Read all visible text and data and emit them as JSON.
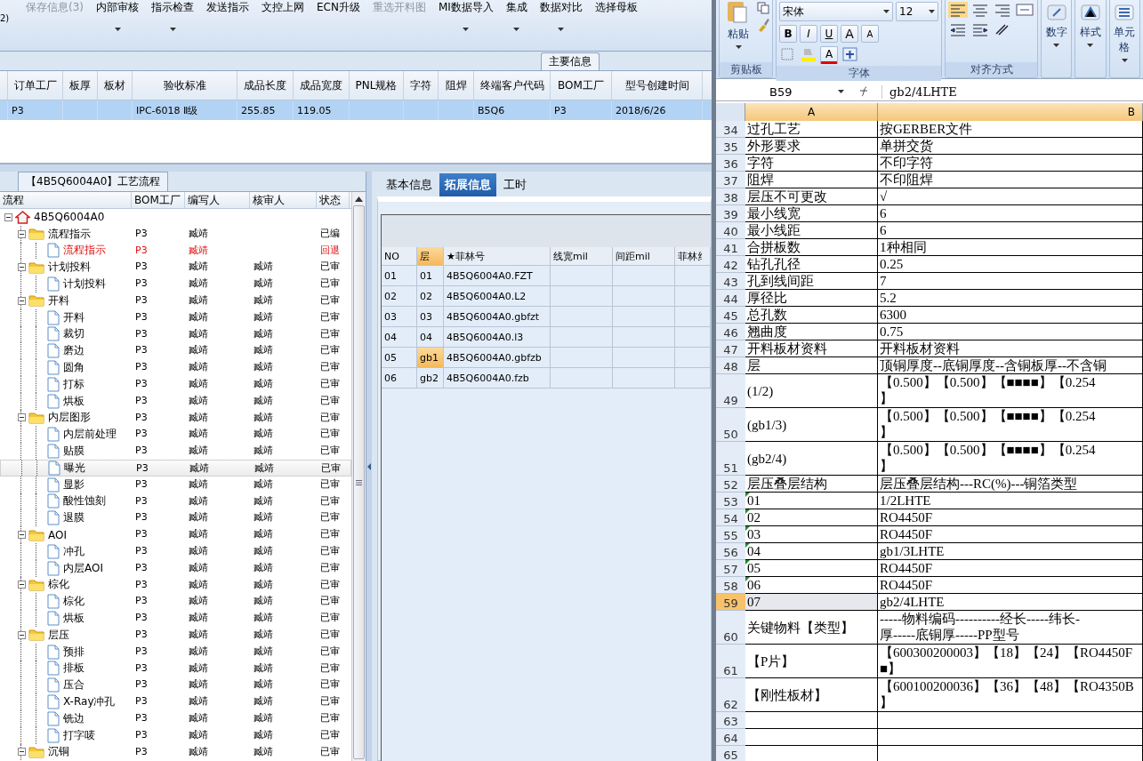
{
  "toolbar": {
    "note": "2)",
    "items": [
      {
        "label": "保存信息(3)",
        "disabled": true,
        "dropdown": false
      },
      {
        "label": "内部审核",
        "disabled": false,
        "dropdown": true
      },
      {
        "label": "指示检查",
        "disabled": false,
        "dropdown": true
      },
      {
        "label": "发送指示",
        "disabled": false,
        "dropdown": false
      },
      {
        "label": "文控上网",
        "disabled": false,
        "dropdown": false
      },
      {
        "label": "ECN升级",
        "disabled": false,
        "dropdown": false
      },
      {
        "label": "重选开料图",
        "disabled": true,
        "dropdown": false
      },
      {
        "label": "MI数据导入",
        "disabled": false,
        "dropdown": true
      },
      {
        "label": "集成",
        "disabled": false,
        "dropdown": true
      },
      {
        "label": "数据对比",
        "disabled": false,
        "dropdown": true
      },
      {
        "label": "选择母板",
        "disabled": false,
        "dropdown": false
      }
    ]
  },
  "main_info": {
    "title": "主要信息",
    "columns": [
      "订单工厂",
      "板厚",
      "板材",
      "验收标准",
      "成品长度",
      "成品宽度",
      "PNL规格",
      "字符",
      "阻焊",
      "终端客户代码",
      "BOM工厂",
      "型号创建时间"
    ],
    "rows": [
      {
        "selected": true,
        "cells": [
          "P3",
          null,
          null,
          "IPC-6018 Ⅱ级",
          "255.85",
          "119.05",
          null,
          null,
          null,
          "B5Q6",
          "P3",
          "2018/6/26"
        ]
      }
    ]
  },
  "process": {
    "title": "【4B5Q6004A0】工艺流程",
    "columns": [
      "流程",
      "BOM工厂",
      "编写人",
      "核审人",
      "状态"
    ],
    "tree": [
      {
        "label": "4B5Q6004A0",
        "kind": "root",
        "expanded": true,
        "alert": false,
        "selected": false,
        "children": [
          {
            "label": "流程指示",
            "kind": "folder",
            "expanded": true,
            "bom": "P3",
            "writer": "臧靖",
            "status": "已编",
            "alert": false,
            "selected": false,
            "children": [
              {
                "label": "流程指示",
                "kind": "doc",
                "bom": "P3",
                "writer": "臧靖",
                "status": "回退",
                "alert": true,
                "selected": false
              }
            ]
          },
          {
            "label": "计划投料",
            "kind": "folder",
            "expanded": true,
            "bom": "P3",
            "writer": "臧靖",
            "reviewer": "臧靖",
            "status": "已审",
            "alert": false,
            "selected": false,
            "children": [
              {
                "label": "计划投料",
                "kind": "doc",
                "bom": "P3",
                "writer": "臧靖",
                "reviewer": "臧靖",
                "status": "已审",
                "alert": false,
                "selected": false
              }
            ]
          },
          {
            "label": "开料",
            "kind": "folder",
            "expanded": true,
            "bom": "P3",
            "writer": "臧靖",
            "reviewer": "臧靖",
            "status": "已审",
            "alert": false,
            "selected": false,
            "children": [
              {
                "label": "开料",
                "kind": "doc",
                "bom": "P3",
                "writer": "臧靖",
                "reviewer": "臧靖",
                "status": "已审",
                "alert": false,
                "selected": false
              },
              {
                "label": "裁切",
                "kind": "doc",
                "bom": "P3",
                "writer": "臧靖",
                "reviewer": "臧靖",
                "status": "已审",
                "alert": false,
                "selected": false
              },
              {
                "label": "磨边",
                "kind": "doc",
                "bom": "P3",
                "writer": "臧靖",
                "reviewer": "臧靖",
                "status": "已审",
                "alert": false,
                "selected": false
              },
              {
                "label": "圆角",
                "kind": "doc",
                "bom": "P3",
                "writer": "臧靖",
                "reviewer": "臧靖",
                "status": "已审",
                "alert": false,
                "selected": false
              },
              {
                "label": "打标",
                "kind": "doc",
                "bom": "P3",
                "writer": "臧靖",
                "reviewer": "臧靖",
                "status": "已审",
                "alert": false,
                "selected": false
              },
              {
                "label": "烘板",
                "kind": "doc",
                "bom": "P3",
                "writer": "臧靖",
                "reviewer": "臧靖",
                "status": "已审",
                "alert": false,
                "selected": false
              }
            ]
          },
          {
            "label": "内层图形",
            "kind": "folder",
            "expanded": true,
            "bom": "P3",
            "writer": "臧靖",
            "reviewer": "臧靖",
            "status": "已审",
            "alert": false,
            "selected": false,
            "children": [
              {
                "label": "内层前处理",
                "kind": "doc",
                "bom": "P3",
                "writer": "臧靖",
                "reviewer": "臧靖",
                "status": "已审",
                "alert": false,
                "selected": false
              },
              {
                "label": "贴膜",
                "kind": "doc",
                "bom": "P3",
                "writer": "臧靖",
                "reviewer": "臧靖",
                "status": "已审",
                "alert": false,
                "selected": false
              },
              {
                "label": "曝光",
                "kind": "doc",
                "bom": "P3",
                "writer": "臧靖",
                "reviewer": "臧靖",
                "status": "已审",
                "alert": false,
                "selected": true
              },
              {
                "label": "显影",
                "kind": "doc",
                "bom": "P3",
                "writer": "臧靖",
                "reviewer": "臧靖",
                "status": "已审",
                "alert": false,
                "selected": false
              },
              {
                "label": "酸性蚀刻",
                "kind": "doc",
                "bom": "P3",
                "writer": "臧靖",
                "reviewer": "臧靖",
                "status": "已审",
                "alert": false,
                "selected": false
              },
              {
                "label": "退膜",
                "kind": "doc",
                "bom": "P3",
                "writer": "臧靖",
                "reviewer": "臧靖",
                "status": "已审",
                "alert": false,
                "selected": false
              }
            ]
          },
          {
            "label": "AOI",
            "kind": "folder",
            "expanded": true,
            "bom": "P3",
            "writer": "臧靖",
            "reviewer": "臧靖",
            "status": "已审",
            "alert": false,
            "selected": false,
            "children": [
              {
                "label": "冲孔",
                "kind": "doc",
                "bom": "P3",
                "writer": "臧靖",
                "reviewer": "臧靖",
                "status": "已审",
                "alert": false,
                "selected": false
              },
              {
                "label": "内层AOI",
                "kind": "doc",
                "bom": "P3",
                "writer": "臧靖",
                "reviewer": "臧靖",
                "status": "已审",
                "alert": false,
                "selected": false
              }
            ]
          },
          {
            "label": "棕化",
            "kind": "folder",
            "expanded": true,
            "bom": "P3",
            "writer": "臧靖",
            "reviewer": "臧靖",
            "status": "已审",
            "alert": false,
            "selected": false,
            "children": [
              {
                "label": "棕化",
                "kind": "doc",
                "bom": "P3",
                "writer": "臧靖",
                "reviewer": "臧靖",
                "status": "已审",
                "alert": false,
                "selected": false
              },
              {
                "label": "烘板",
                "kind": "doc",
                "bom": "P3",
                "writer": "臧靖",
                "reviewer": "臧靖",
                "status": "已审",
                "alert": false,
                "selected": false
              }
            ]
          },
          {
            "label": "层压",
            "kind": "folder",
            "expanded": true,
            "bom": "P3",
            "writer": "臧靖",
            "reviewer": "臧靖",
            "status": "已审",
            "alert": false,
            "selected": false,
            "children": [
              {
                "label": "预排",
                "kind": "doc",
                "bom": "P3",
                "writer": "臧靖",
                "reviewer": "臧靖",
                "status": "已审",
                "alert": false,
                "selected": false
              },
              {
                "label": "排板",
                "kind": "doc",
                "bom": "P3",
                "writer": "臧靖",
                "reviewer": "臧靖",
                "status": "已审",
                "alert": false,
                "selected": false
              },
              {
                "label": "压合",
                "kind": "doc",
                "bom": "P3",
                "writer": "臧靖",
                "reviewer": "臧靖",
                "status": "已审",
                "alert": false,
                "selected": false
              },
              {
                "label": "X-Ray冲孔",
                "kind": "doc",
                "bom": "P3",
                "writer": "臧靖",
                "reviewer": "臧靖",
                "status": "已审",
                "alert": false,
                "selected": false
              },
              {
                "label": "铣边",
                "kind": "doc",
                "bom": "P3",
                "writer": "臧靖",
                "reviewer": "臧靖",
                "status": "已审",
                "alert": false,
                "selected": false
              },
              {
                "label": "打字唛",
                "kind": "doc",
                "bom": "P3",
                "writer": "臧靖",
                "reviewer": "臧靖",
                "status": "已审",
                "alert": false,
                "selected": false
              }
            ]
          },
          {
            "label": "沉铜",
            "kind": "folder",
            "expanded": true,
            "bom": "P3",
            "writer": "臧靖",
            "reviewer": "臧靖",
            "status": "已审",
            "alert": false,
            "selected": false
          }
        ]
      }
    ]
  },
  "detail": {
    "tabs": [
      {
        "label": "基本信息",
        "selected": false
      },
      {
        "label": "拓展信息",
        "selected": true
      },
      {
        "label": "工时",
        "selected": false
      }
    ],
    "columns": [
      {
        "label": "NO",
        "selected": false
      },
      {
        "label": "层",
        "selected": true
      },
      {
        "label": "★菲林号",
        "selected": false
      },
      {
        "label": "线宽mil",
        "selected": false
      },
      {
        "label": "间距mil",
        "selected": false
      },
      {
        "label": "菲林纟",
        "selected": false
      }
    ],
    "rows": [
      {
        "no": "01",
        "layer": "01",
        "film": "4B5Q6004A0.FZT",
        "layer_selected": false
      },
      {
        "no": "02",
        "layer": "02",
        "film": "4B5Q6004A0.L2",
        "layer_selected": false
      },
      {
        "no": "03",
        "layer": "03",
        "film": "4B5Q6004A0.gbfzt",
        "layer_selected": false
      },
      {
        "no": "04",
        "layer": "04",
        "film": "4B5Q6004A0.l3",
        "layer_selected": false
      },
      {
        "no": "05",
        "layer": "gb1",
        "film": "4B5Q6004A0.gbfzb",
        "layer_selected": true
      },
      {
        "no": "06",
        "layer": "gb2",
        "film": "4B5Q6004A0.fzb",
        "layer_selected": false
      }
    ]
  },
  "excel": {
    "ribbon": {
      "paste": "粘贴",
      "font_name": "宋体",
      "font_size": "12",
      "format_buttons": [
        "B",
        "I",
        "U"
      ],
      "grow_buttons": [
        "A",
        "A"
      ],
      "font_color_button": "A",
      "groups": [
        "剪贴板",
        "字体",
        "对齐方式"
      ],
      "big_buttons": [
        "数字",
        "样式",
        "单元格"
      ]
    },
    "name_box": "B59",
    "formula": "gb2/4LHTE",
    "columns": [
      "A",
      "B"
    ],
    "rows": [
      {
        "row": "34",
        "a": "过孔工艺",
        "b": [
          "按GERBER文件"
        ],
        "flag": false,
        "selected": false
      },
      {
        "row": "35",
        "a": "外形要求",
        "b": [
          "单拼交货"
        ],
        "flag": false,
        "selected": false
      },
      {
        "row": "36",
        "a": "字符",
        "b": [
          "不印字符"
        ],
        "flag": false,
        "selected": false
      },
      {
        "row": "37",
        "a": "阻焊",
        "b": [
          "不印阻焊"
        ],
        "flag": false,
        "selected": false
      },
      {
        "row": "38",
        "a": "层压不可更改",
        "b": [
          "√"
        ],
        "flag": false,
        "selected": false
      },
      {
        "row": "39",
        "a": "最小线宽",
        "b": [
          "6"
        ],
        "flag": false,
        "selected": false
      },
      {
        "row": "40",
        "a": "最小线距",
        "b": [
          "6"
        ],
        "flag": false,
        "selected": false
      },
      {
        "row": "41",
        "a": "合拼板数",
        "b": [
          "1种相同"
        ],
        "flag": false,
        "selected": false
      },
      {
        "row": "42",
        "a": "钻孔孔径",
        "b": [
          "0.25"
        ],
        "flag": false,
        "selected": false
      },
      {
        "row": "43",
        "a": "孔到线间距",
        "b": [
          "7"
        ],
        "flag": false,
        "selected": false
      },
      {
        "row": "44",
        "a": "厚径比",
        "b": [
          "5.2"
        ],
        "flag": false,
        "selected": false
      },
      {
        "row": "45",
        "a": "总孔数",
        "b": [
          "6300"
        ],
        "flag": false,
        "selected": false
      },
      {
        "row": "46",
        "a": "翘曲度",
        "b": [
          "0.75"
        ],
        "flag": false,
        "selected": false
      },
      {
        "row": "47",
        "a": "开料板材资料",
        "b": [
          "开料板材资料"
        ],
        "flag": false,
        "selected": false
      },
      {
        "row": "48",
        "a": "层",
        "b": [
          "顶铜厚度--底铜厚度--含铜板厚--不含铜"
        ],
        "flag": false,
        "selected": false
      },
      {
        "row": "49",
        "a": "(1/2)",
        "b": [
          "【0.500】【0.500】【■■■■】【0.254",
          "】"
        ],
        "flag": false,
        "selected": false
      },
      {
        "row": "50",
        "a": "(gb1/3)",
        "b": [
          "【0.500】【0.500】【■■■■】【0.254",
          "】"
        ],
        "flag": false,
        "selected": false
      },
      {
        "row": "51",
        "a": "(gb2/4)",
        "b": [
          "【0.500】【0.500】【■■■■】【0.254",
          "】"
        ],
        "flag": false,
        "selected": false
      },
      {
        "row": "52",
        "a": "层压叠层结构",
        "b": [
          "层压叠层结构---RC(%)---铜箔类型"
        ],
        "flag": false,
        "selected": false
      },
      {
        "row": "53",
        "a": "01",
        "b": [
          "1/2LHTE"
        ],
        "flag": true,
        "selected": false
      },
      {
        "row": "54",
        "a": "02",
        "b": [
          "RO4450F"
        ],
        "flag": true,
        "selected": false
      },
      {
        "row": "55",
        "a": "03",
        "b": [
          "RO4450F"
        ],
        "flag": true,
        "selected": false
      },
      {
        "row": "56",
        "a": "04",
        "b": [
          "gb1/3LHTE"
        ],
        "flag": true,
        "selected": false
      },
      {
        "row": "57",
        "a": "05",
        "b": [
          "RO4450F"
        ],
        "flag": true,
        "selected": false
      },
      {
        "row": "58",
        "a": "06",
        "b": [
          "RO4450F"
        ],
        "flag": true,
        "selected": false
      },
      {
        "row": "59",
        "a": "07",
        "b": [
          "gb2/4LHTE"
        ],
        "flag": false,
        "selected": true
      },
      {
        "row": "60",
        "a": "关键物料【类型】",
        "b": [
          "-----物料编码----------经长-----纬长-",
          "厚-----底铜厚-----PP型号"
        ],
        "flag": false,
        "selected": false
      },
      {
        "row": "61",
        "a": "【P片】",
        "b": [
          "【600300200003】【18】【24】【RO4450F",
          "■】"
        ],
        "flag": false,
        "selected": false
      },
      {
        "row": "62",
        "a": "【刚性板材】",
        "b": [
          "【600100200036】【36】【48】【RO4350B",
          "】"
        ],
        "flag": false,
        "selected": false
      },
      {
        "row": "63",
        "flag": false,
        "selected": false
      },
      {
        "row": "64",
        "flag": false,
        "selected": false
      },
      {
        "row": "65",
        "flag": false,
        "selected": false
      }
    ]
  }
}
